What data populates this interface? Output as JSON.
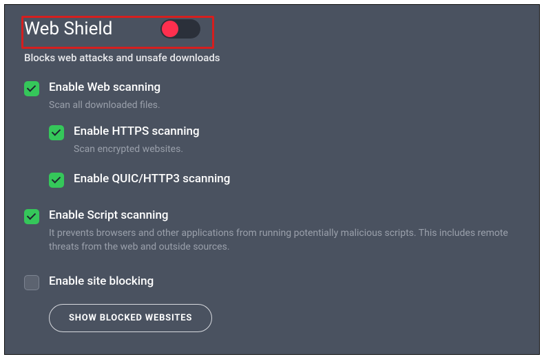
{
  "header": {
    "title": "Web Shield",
    "subtitle": "Blocks web attacks and unsafe downloads"
  },
  "options": {
    "web": {
      "label": "Enable Web scanning",
      "desc": "Scan all downloaded files.",
      "https": {
        "label": "Enable HTTPS scanning",
        "desc": "Scan encrypted websites."
      },
      "quic": {
        "label": "Enable QUIC/HTTP3 scanning"
      }
    },
    "script": {
      "label": "Enable Script scanning",
      "desc": "It prevents browsers and other applications from running potentially malicious scripts. This includes remote threats from the web and outside sources."
    },
    "siteblock": {
      "label": "Enable site blocking",
      "button": "SHOW BLOCKED WEBSITES"
    }
  }
}
